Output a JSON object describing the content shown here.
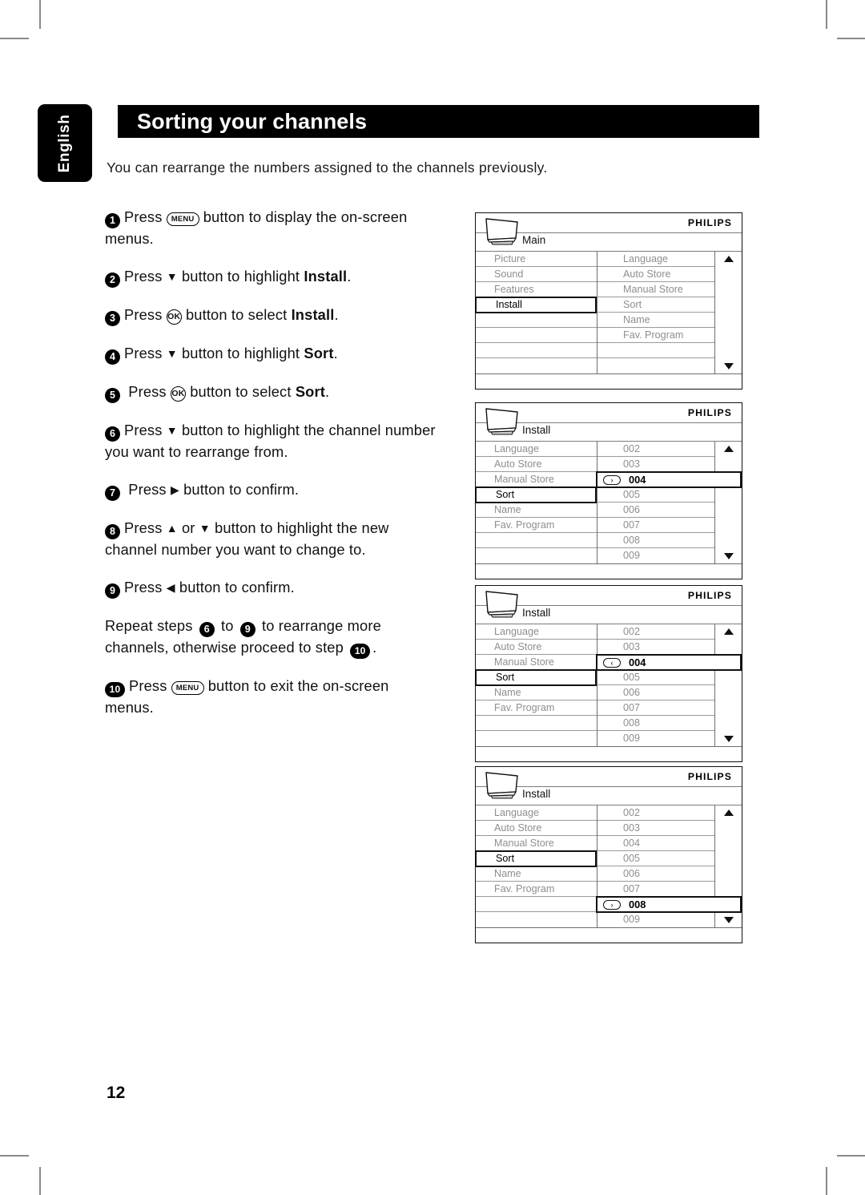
{
  "page": {
    "language_tab": "English",
    "title": "Sorting your channels",
    "intro": "You can rearrange the numbers assigned to the channels previously.",
    "page_number": "12"
  },
  "steps": [
    {
      "num": "1",
      "text_before": "Press",
      "key": "MENU",
      "text_after": "button to display the on-screen menus."
    },
    {
      "num": "2",
      "text_before": "Press",
      "key": "▼",
      "text_after": "button to highlight",
      "emphasis": "Install",
      "tail": "."
    },
    {
      "num": "3",
      "text_before": "Press",
      "key": "OK",
      "text_after": "button to select",
      "emphasis": "Install",
      "tail": "."
    },
    {
      "num": "4",
      "text_before": "Press",
      "key": "▼",
      "text_after": "button to highlight",
      "emphasis": "Sort",
      "tail": "."
    },
    {
      "num": "5",
      "text_before": "Press",
      "key": "OK",
      "text_after": "button to select",
      "emphasis": "Sort",
      "tail": "."
    },
    {
      "num": "6",
      "text_before": "Press",
      "key": "▼",
      "text_after": "button to highlight the channel number you want to rearrange from."
    },
    {
      "num": "7",
      "text_before": "Press",
      "key": "▶",
      "text_after": "button to confirm."
    },
    {
      "num": "8",
      "text_before": "Press",
      "key": "▲",
      "mid": "or",
      "key2": "▼",
      "text_after": "button to highlight the new channel number you want to change to."
    },
    {
      "num": "9",
      "text_before": "Press",
      "key": "◀",
      "text_after": "button to confirm."
    },
    {
      "num": "10",
      "text_before": "Press",
      "key": "MENU",
      "text_after": "button to exit the on-screen menus."
    }
  ],
  "repeat_note": {
    "lead": "Repeat steps",
    "from_step": "6",
    "joiner": "to",
    "to_step": "9",
    "middle": "to rearrange more channels, otherwise proceed to step",
    "final_step": "10",
    "tail": "."
  },
  "panels": [
    {
      "id": "main-menu",
      "brand": "PHILIPS",
      "menu_name": "Main",
      "left_items": [
        "Picture",
        "Sound",
        "Features",
        "Install",
        "",
        "",
        "",
        ""
      ],
      "right_items": [
        "Language",
        "Auto Store",
        "Manual Store",
        "Sort",
        "Name",
        "Fav. Program",
        "",
        ""
      ],
      "highlight_left_index": 3,
      "highlight_left_label": "Install",
      "highlight_right_index": null,
      "highlight_right_label": null,
      "highlight_right_arrow": null,
      "scroll_up": "▲",
      "scroll_down": "▼"
    },
    {
      "id": "install-sort-004-right",
      "brand": "PHILIPS",
      "menu_name": "Install",
      "left_items": [
        "Language",
        "Auto Store",
        "Manual Store",
        "Sort",
        "Name",
        "Fav. Program",
        "",
        ""
      ],
      "right_items": [
        "002",
        "003",
        "004",
        "005",
        "006",
        "007",
        "008",
        "009"
      ],
      "highlight_left_index": 3,
      "highlight_left_label": "Sort",
      "highlight_right_index": 2,
      "highlight_right_label": "004",
      "highlight_right_arrow": "›",
      "scroll_up": "▲",
      "scroll_down": "▼"
    },
    {
      "id": "install-sort-004-left",
      "brand": "PHILIPS",
      "menu_name": "Install",
      "left_items": [
        "Language",
        "Auto Store",
        "Manual Store",
        "Sort",
        "Name",
        "Fav. Program",
        "",
        ""
      ],
      "right_items": [
        "002",
        "003",
        "004",
        "005",
        "006",
        "007",
        "008",
        "009"
      ],
      "highlight_left_index": 3,
      "highlight_left_label": "Sort",
      "highlight_right_index": 2,
      "highlight_right_label": "004",
      "highlight_right_arrow": "‹",
      "scroll_up": "▲",
      "scroll_down": "▼"
    },
    {
      "id": "install-sort-008-right",
      "brand": "PHILIPS",
      "menu_name": "Install",
      "left_items": [
        "Language",
        "Auto Store",
        "Manual Store",
        "Sort",
        "Name",
        "Fav. Program",
        "",
        ""
      ],
      "right_items": [
        "002",
        "003",
        "004",
        "005",
        "006",
        "007",
        "008",
        "009"
      ],
      "highlight_left_index": 3,
      "highlight_left_label": "Sort",
      "highlight_right_index": 6,
      "highlight_right_label": "008",
      "highlight_right_arrow": "›",
      "scroll_up": "▲",
      "scroll_down": "▼"
    }
  ],
  "colors": {
    "ink": "#000000",
    "menu_dim_text": "#8e8e8e",
    "menu_rule": "#9a9a9a",
    "crop_mark": "#8a8a8a"
  }
}
